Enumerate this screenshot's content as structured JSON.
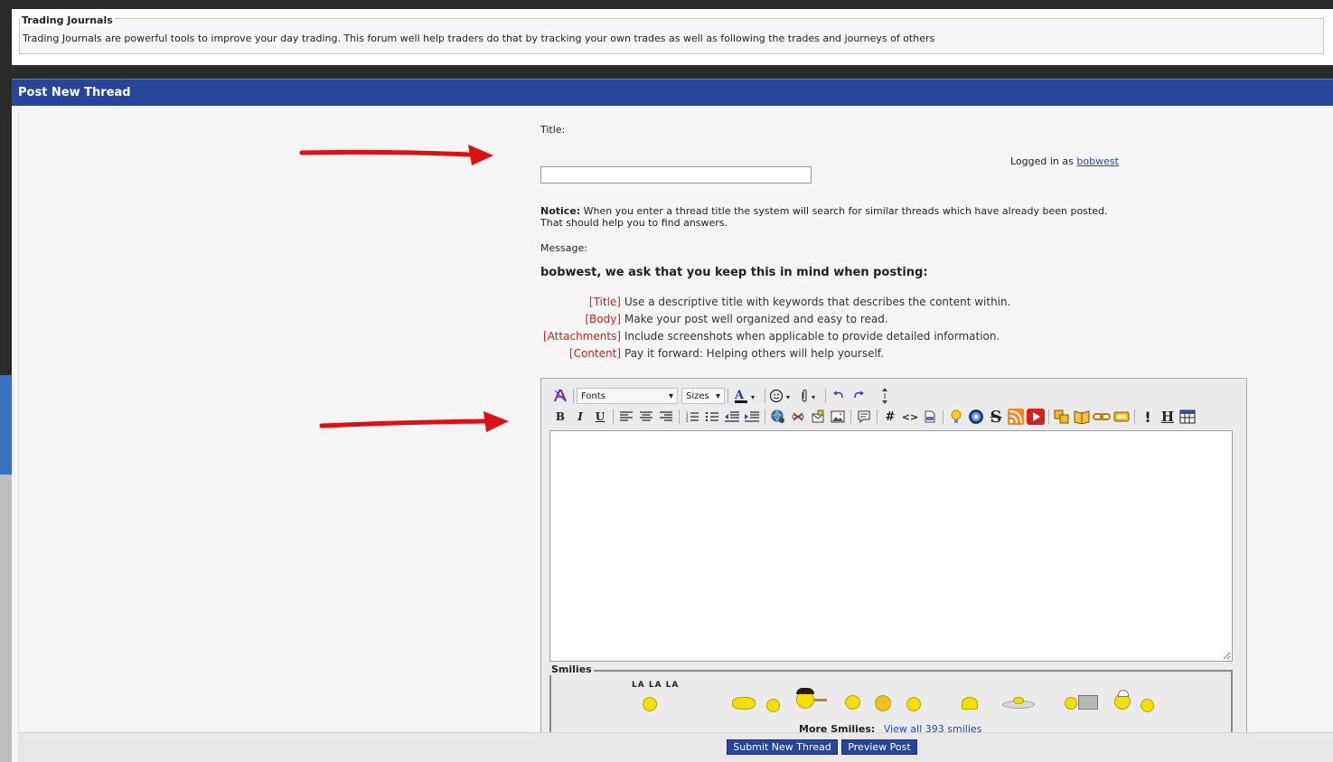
{
  "forum": {
    "legend": "Trading Journals",
    "description": "Trading Journals are powerful tools to improve your day trading. This forum well help traders do that by tracking your own trades as well as following the trades and journeys of others"
  },
  "header": {
    "title": "Post New Thread"
  },
  "form": {
    "title_label": "Title:",
    "logged_in_prefix": "Logged in as",
    "username": "bobwest",
    "notice_label": "Notice:",
    "notice_text": "When you enter a thread title the system will search for similar threads which have already been posted.",
    "notice_text2": "That should help you to find answers.",
    "message_label": "Message:",
    "keep_in_mind": "bobwest, we ask that you keep this in mind when posting:",
    "rules": [
      {
        "tag": "[Title]",
        "text": "Use a descriptive title with keywords that describes the content within."
      },
      {
        "tag": "[Body]",
        "text": "Make your post well organized and easy to read."
      },
      {
        "tag": "[Attachments]",
        "text": "Include screenshots when applicable to provide detailed information."
      },
      {
        "tag": "[Content]",
        "text": "Pay it forward: Helping others will help yourself."
      }
    ]
  },
  "editor": {
    "fonts_select": "Fonts",
    "sizes_select": "Sizes",
    "bold": "B",
    "italic": "I",
    "underline": "U",
    "hash": "#",
    "code": "<>",
    "exclaim": "!",
    "h": "H",
    "s": "S"
  },
  "smilies": {
    "legend": "Smilies",
    "lala": "LA LA LA",
    "more_label": "More Smilies:",
    "more_link": "View all 393 smilies"
  },
  "buttons": {
    "submit": "Submit New Thread",
    "preview": "Preview Post"
  },
  "colors": {
    "header_blue": "#27469a",
    "rule_tag_red": "#cc2222",
    "link_blue": "#2a49a8",
    "annotation_arrow": "#e01010"
  }
}
